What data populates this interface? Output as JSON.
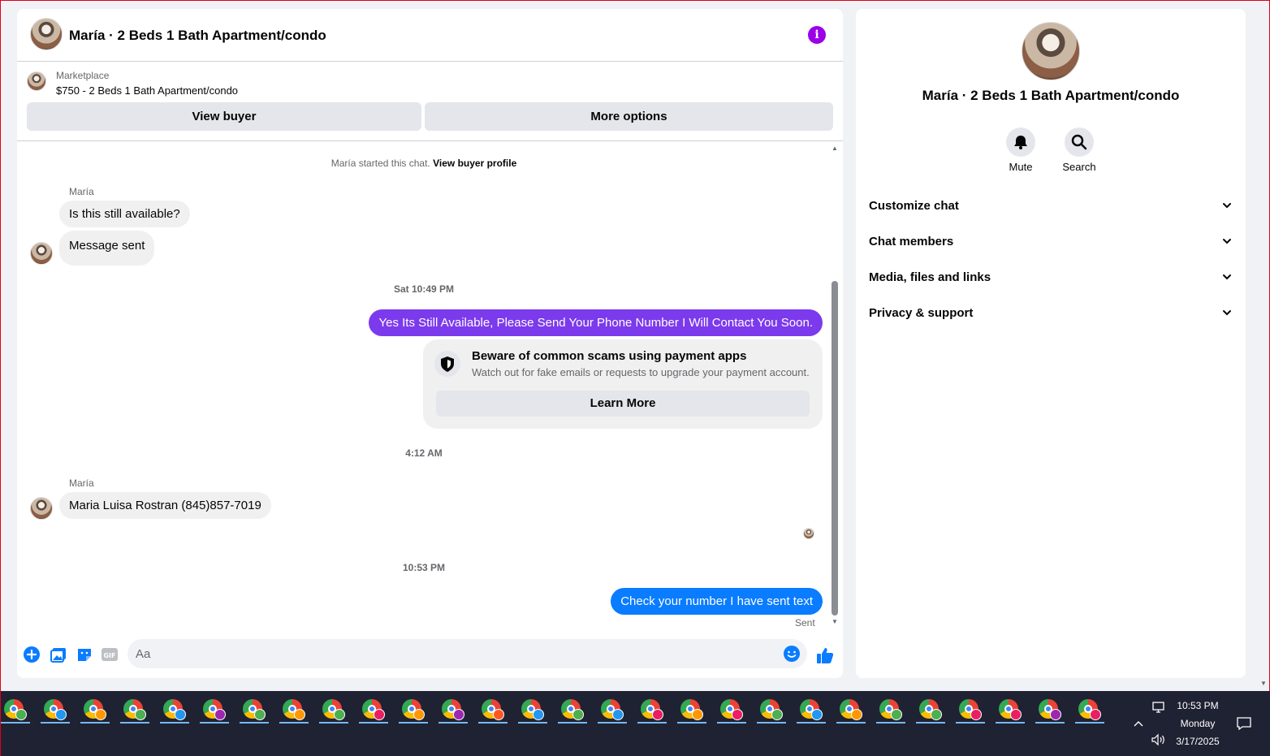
{
  "chat": {
    "title": "María · 2 Beds 1 Bath Apartment/condo",
    "marketplace_label": "Marketplace",
    "listing": "$750 - 2 Beds 1 Bath Apartment/condo",
    "view_buyer_label": "View buyer",
    "more_options_label": "More options",
    "started_text": "María started this chat.",
    "view_buyer_profile_label": "View buyer profile",
    "messages": [
      {
        "sender": "María",
        "text": "Is this still available?"
      },
      {
        "text": "Message sent"
      },
      {
        "timestamp": "Sat 10:49 PM"
      },
      {
        "outgoing": true,
        "text": "Yes Its Still Available, Please Send Your Phone Number I Will Contact You Soon.",
        "color": "#7c3aed"
      },
      {
        "timestamp": "4:12 AM"
      },
      {
        "sender": "María",
        "text": "Maria Luisa Rostran (845)857-7019"
      },
      {
        "timestamp": "10:53 PM"
      },
      {
        "outgoing": true,
        "text": "Check your number I have sent text",
        "color": "#0a7cff"
      }
    ],
    "scam_card": {
      "title": "Beware of common scams using payment apps",
      "description": "Watch out for fake emails or requests to upgrade your payment account.",
      "button_label": "Learn More"
    },
    "sent_status": "Sent",
    "composer": {
      "placeholder": "Aa",
      "value": ""
    }
  },
  "side_panel": {
    "title": "María · 2 Beds 1 Bath Apartment/condo",
    "actions": [
      {
        "label": "Mute",
        "icon": "bell-icon"
      },
      {
        "label": "Search",
        "icon": "search-icon"
      }
    ],
    "sections": [
      "Customize chat",
      "Chat members",
      "Media, files and links",
      "Privacy & support"
    ]
  },
  "taskbar": {
    "time": "10:53 PM",
    "day": "Monday",
    "date": "3/17/2025",
    "badge_colors": [
      "#4caf50",
      "#2196f3",
      "#ff9800",
      "#4caf50",
      "#2196f3",
      "#9c27b0",
      "#4caf50",
      "#ff9800",
      "#4caf50",
      "#e91e63",
      "#ff9800",
      "#9c27b0",
      "#ff5722",
      "#2196f3",
      "#4caf50",
      "#2196f3",
      "#e91e63",
      "#ff9800",
      "#e91e63",
      "#4caf50",
      "#2196f3",
      "#ff9800",
      "#4caf50",
      "#4caf50",
      "#e91e63",
      "#e91e63",
      "#9c27b0",
      "#e91e63"
    ]
  },
  "colors": {
    "accent_purple": "#7c3aed",
    "messenger_blue": "#0a7cff",
    "info_purple": "#9b00e8"
  }
}
